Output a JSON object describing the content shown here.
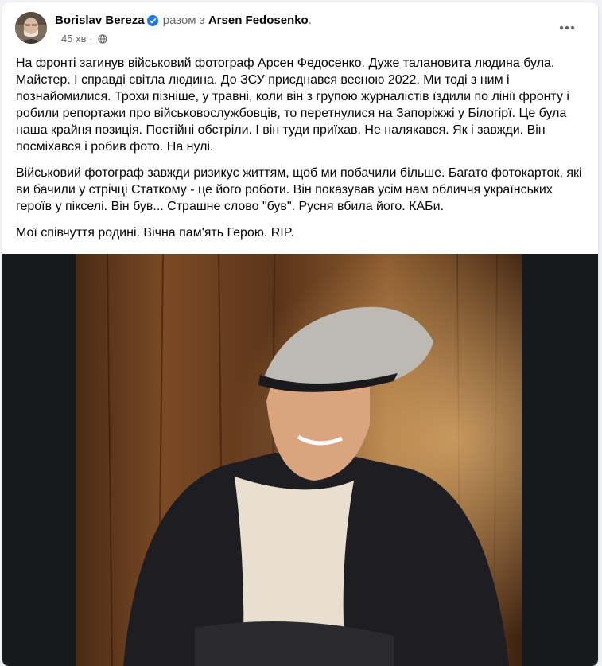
{
  "post": {
    "author": "Borislav Bereza",
    "with_text": "разом з",
    "coauthor": "Arsen Fedosenko",
    "coauthor_suffix": ".",
    "time": "45 хв",
    "dot": "·",
    "privacy_icon": "globe-icon",
    "more_icon": "more-options-icon",
    "paragraphs": [
      "На фронті загинув військовий фотограф Арсен Федосенко. Дуже талановита людина була. Майстер. І справді світла людина. До ЗСУ приєднався весною 2022. Ми тоді з ним і познайомилися. Трохи пізніше, у травні, коли він з групою журналістів їздили по лінії фронту і робили репортажи про військовослужбовців, то перетнулися на Запоріжжі у Білогірї. Це була наша крайня позиція. Постійні обстріли. І він туди приїхав. Не налякався. Як і завжди. Він посміхався і робив фото. На нулі.",
      "Військовий фотограф завжди ризикує життям, щоб ми побачили більше. Багато фотокарток, які ви бачили у стрічці Статкому - це його роботи. Він показував усім нам обличчя українських героїв у пікселі. Він був... Страшне слово \"був\". Русня вбила його. КАБи.",
      "Мої співчуття родині. Вічна пам'ять Герою. RIP."
    ]
  },
  "colors": {
    "verified": "#1877f2",
    "secondary_text": "#65676b",
    "photo_background": "#18191a"
  }
}
